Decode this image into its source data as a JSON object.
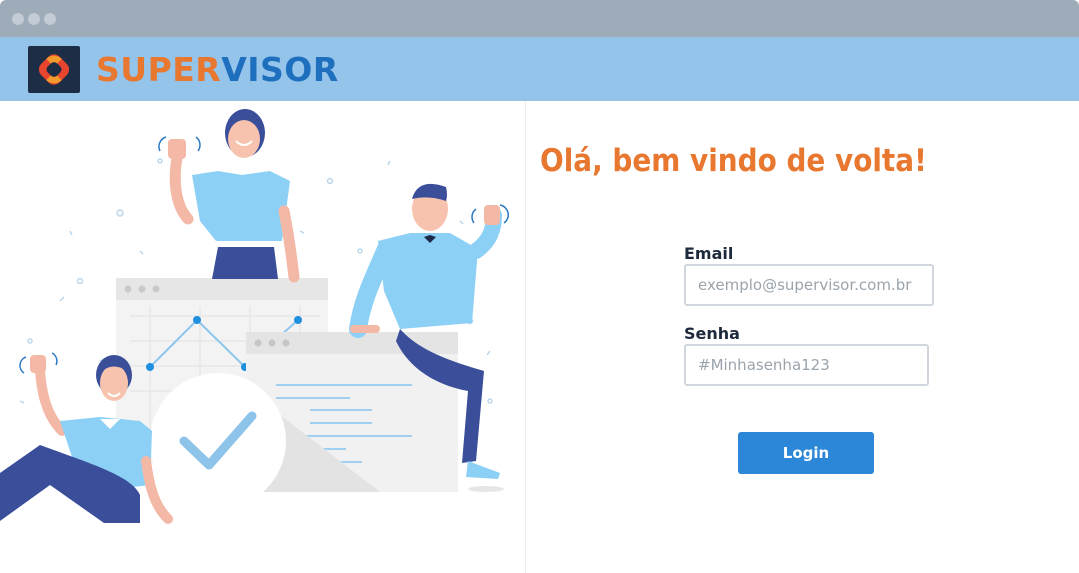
{
  "brand": {
    "name_part1": "SUPER",
    "name_part2": "VISOR",
    "color_part1": "#e8772f",
    "color_part2": "#1f6fbf",
    "logo_icon": "supervisor-logo-icon"
  },
  "login": {
    "welcome": "Olá, bem vindo de volta!",
    "email_label": "Email",
    "email_placeholder": "exemplo@supervisor.com.br",
    "password_label": "Senha",
    "password_placeholder": "#Minhasenha123",
    "submit_label": "Login"
  },
  "colors": {
    "accent": "#e8772f",
    "primary_button": "#2d87d8",
    "header_bg": "#95c4eb"
  }
}
